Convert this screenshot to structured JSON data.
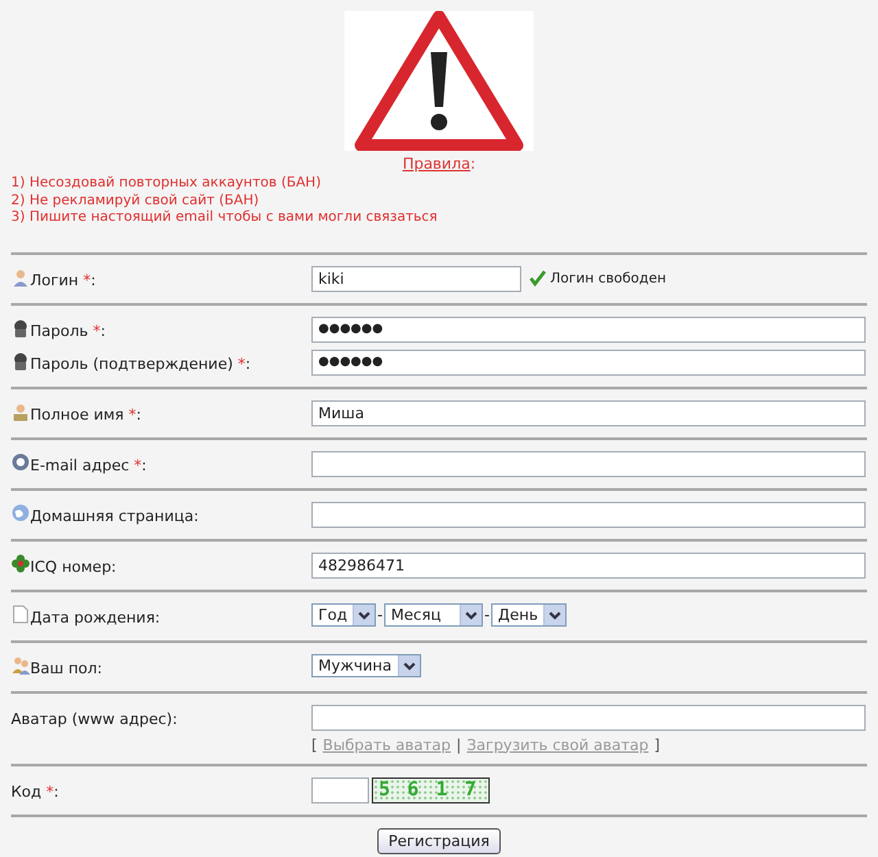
{
  "rules": {
    "link": "Правила",
    "link_end": ":",
    "items": [
      "1) Несоздовай повторных аккаунтов (БАН)",
      "2) Не рекламируй свой сайт (БАН)",
      "3) Пишите настоящий email чтобы с вами могли связаться"
    ]
  },
  "sections": [
    {
      "rows": [
        {
          "kind": "text",
          "label": "Логин",
          "required_mark": "*",
          "label_end": ":",
          "value": "kiki",
          "short": true,
          "status": {
            "text": "Логин свободен",
            "ok": true
          }
        }
      ]
    },
    {
      "rows": [
        {
          "kind": "text",
          "label": "Пароль",
          "required_mark": "*",
          "label_end": ":",
          "value": "●●●●●●",
          "secret": true
        },
        {
          "kind": "text",
          "label": "Пароль (подтверждение)",
          "required_mark": "*",
          "label_end": ":",
          "value": "●●●●●●",
          "secret": true
        }
      ]
    },
    {
      "rows": [
        {
          "kind": "text",
          "label": "Полное имя",
          "required_mark": "*",
          "label_end": ":",
          "value": "Миша"
        }
      ]
    },
    {
      "rows": [
        {
          "kind": "text",
          "label": "E-mail адрес",
          "required_mark": "*",
          "label_end": ":"
        }
      ]
    },
    {
      "rows": [
        {
          "kind": "text",
          "label": "Домашняя страница:"
        }
      ]
    },
    {
      "rows": [
        {
          "kind": "text",
          "label": "ICQ номер:",
          "value": "482986471"
        }
      ]
    },
    {
      "rows": [
        {
          "kind": "date",
          "label": "Дата рождения:",
          "parts": [
            {
              "kind": "select",
              "value": "Год"
            },
            {
              "kind": "sep",
              "text": "-"
            },
            {
              "kind": "select",
              "value": "Месяц",
              "wide": true
            },
            {
              "kind": "sep",
              "text": "-"
            },
            {
              "kind": "select",
              "value": "День"
            }
          ]
        }
      ]
    },
    {
      "rows": [
        {
          "kind": "select",
          "label": "Ваш пол:",
          "value": "Мужчина"
        }
      ]
    },
    {
      "rows": [
        {
          "kind": "avatar",
          "label": "Аватар (www адрес):",
          "links": [
            {
              "kind": "punct",
              "text": "["
            },
            {
              "kind": "link",
              "text": "Выбрать аватар"
            },
            {
              "kind": "punct",
              "text": "|"
            },
            {
              "kind": "link",
              "text": "Загрузить свой аватар"
            },
            {
              "kind": "punct",
              "text": "]"
            }
          ]
        }
      ]
    },
    {
      "rows": [
        {
          "kind": "captcha",
          "label": "Код",
          "required_mark": "*",
          "label_end": ":",
          "code": "5 6 1 7"
        }
      ]
    }
  ],
  "submit": "Регистрация"
}
